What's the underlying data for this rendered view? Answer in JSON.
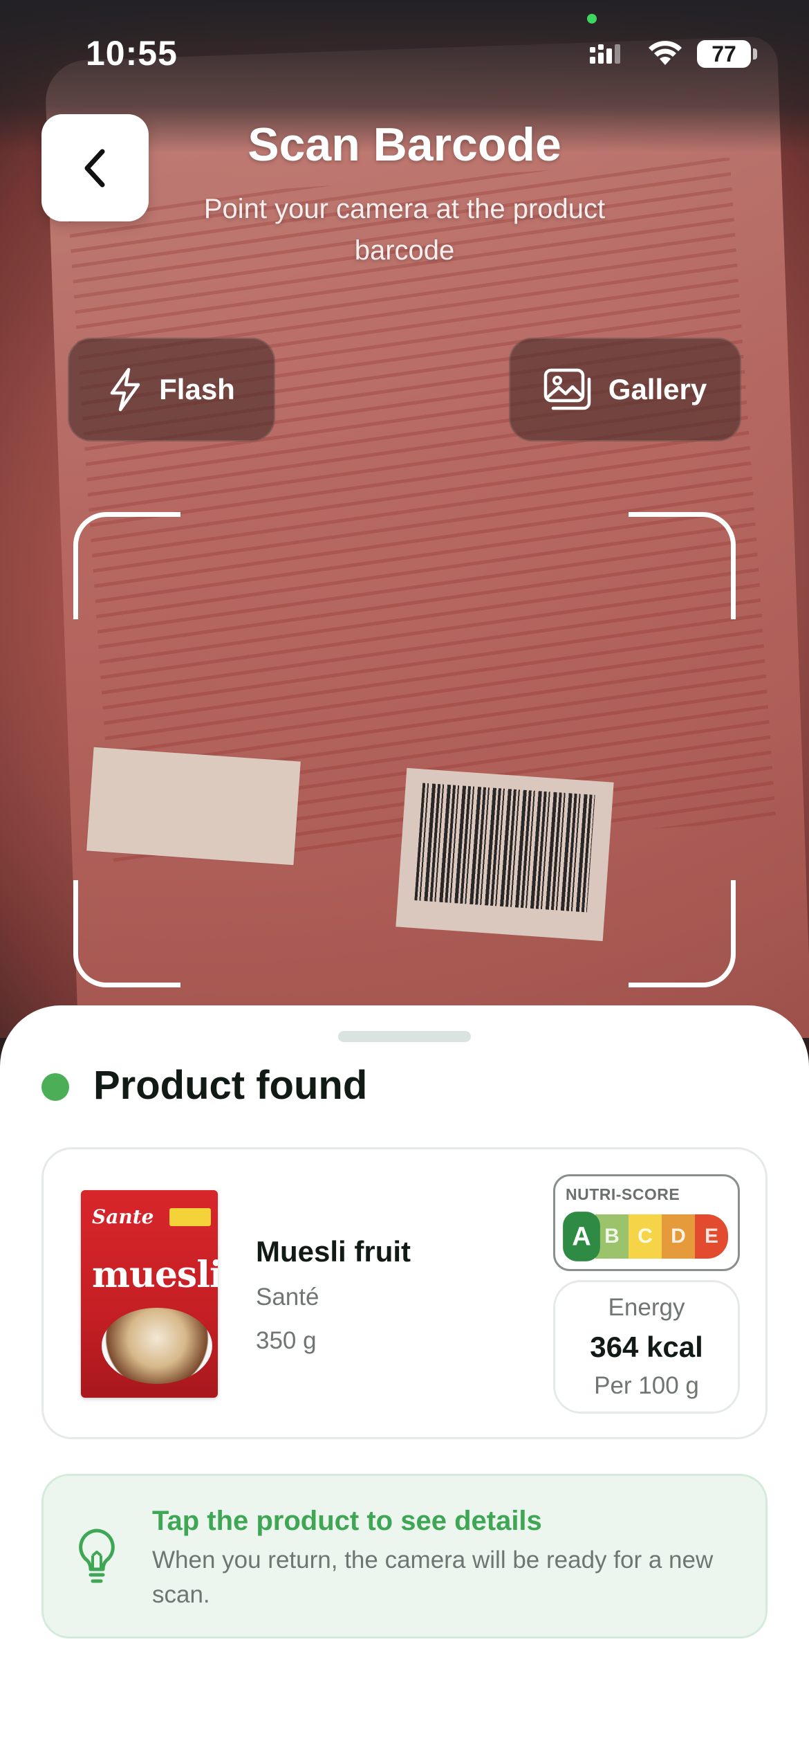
{
  "status_bar": {
    "time": "10:55",
    "battery": "77"
  },
  "header": {
    "title": "Scan Barcode",
    "subtitle": "Point your camera at the product barcode",
    "back_icon": "chevron-left-icon"
  },
  "camera_actions": {
    "flash_label": "Flash",
    "flash_icon": "lightning-icon",
    "gallery_label": "Gallery",
    "gallery_icon": "image-icon"
  },
  "result": {
    "status_title": "Product found",
    "status_color": "#4caf57",
    "product": {
      "name": "Muesli fruit",
      "brand": "Santé",
      "weight": "350 g",
      "image_brand": "Sante",
      "image_name": "muesli"
    },
    "nutri_score": {
      "label": "NUTRI-SCORE",
      "grades": [
        "A",
        "B",
        "C",
        "D",
        "E"
      ],
      "selected": "A"
    },
    "energy": {
      "label": "Energy",
      "value": "364 kcal",
      "unit": "Per 100 g"
    },
    "hint": {
      "icon": "lightbulb-icon",
      "title": "Tap the product to see details",
      "body": "When you return, the camera will be ready for a new scan."
    }
  },
  "colors": {
    "accent_green": "#3ea655",
    "hint_background": "#ecf6ef"
  }
}
